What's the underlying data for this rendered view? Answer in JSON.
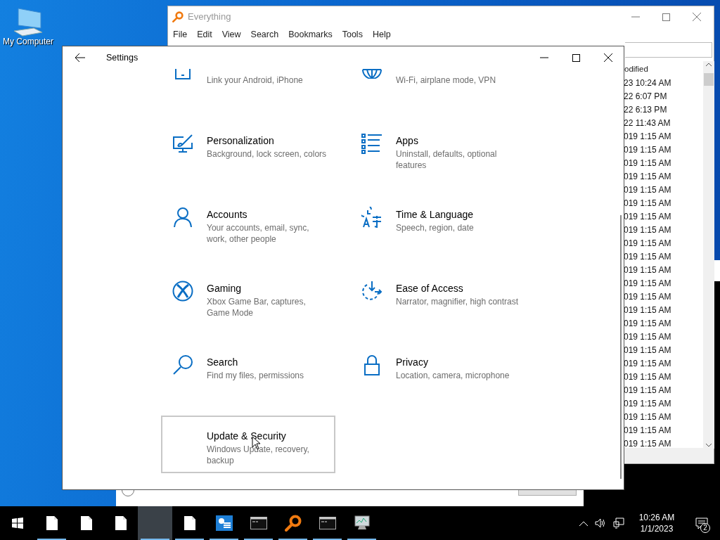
{
  "desktop": {
    "icons": [
      {
        "kind": "computer",
        "label": "My Computer"
      }
    ]
  },
  "everything_window": {
    "title": "Everything",
    "menu": [
      "File",
      "Edit",
      "View",
      "Search",
      "Bookmarks",
      "Tools",
      "Help"
    ],
    "column_header": "odified",
    "rows": [
      "23 10:24 AM",
      "22 6:07 PM",
      "22 6:13 PM",
      "22 11:43 AM",
      "019 1:15 AM",
      "019 1:15 AM",
      "019 1:15 AM",
      "019 1:15 AM",
      "019 1:15 AM",
      "019 1:15 AM",
      "019 1:15 AM",
      "019 1:15 AM",
      "019 1:15 AM",
      "019 1:15 AM",
      "019 1:15 AM",
      "019 1:15 AM",
      "019 1:15 AM",
      "019 1:15 AM",
      "019 1:15 AM",
      "019 1:15 AM",
      "019 1:15 AM",
      "019 1:15 AM",
      "019 1:15 AM",
      "019 1:15 AM",
      "019 1:15 AM",
      "019 1:15 AM",
      "019 1:15 AM",
      "019 1:15 AM"
    ]
  },
  "task_manager_window": {
    "option": {
      "selected": false
    }
  },
  "settings_window": {
    "title": "Settings",
    "items": [
      {
        "kind": "phone",
        "subtitle": "Link your Android, iPhone",
        "selected": false
      },
      {
        "kind": "network",
        "subtitle": "Wi-Fi, airplane mode, VPN",
        "selected": false
      },
      {
        "kind": "personalization",
        "title": "Personalization",
        "subtitle": "Background, lock screen, colors",
        "selected": false
      },
      {
        "kind": "apps",
        "title": "Apps",
        "subtitle": "Uninstall, defaults, optional features",
        "selected": false
      },
      {
        "kind": "accounts",
        "title": "Accounts",
        "subtitle": "Your accounts, email, sync, work, other people",
        "selected": false
      },
      {
        "kind": "time",
        "title": "Time & Language",
        "subtitle": "Speech, region, date",
        "selected": false
      },
      {
        "kind": "gaming",
        "title": "Gaming",
        "subtitle": "Xbox Game Bar, captures, Game Mode",
        "selected": false
      },
      {
        "kind": "ease",
        "title": "Ease of Access",
        "subtitle": "Narrator, magnifier, high contrast",
        "selected": false
      },
      {
        "kind": "search",
        "title": "Search",
        "subtitle": "Find my files, permissions",
        "selected": false
      },
      {
        "kind": "privacy",
        "title": "Privacy",
        "subtitle": "Location, camera, microphone",
        "selected": false
      },
      {
        "kind": "update",
        "title": "Update & Security",
        "subtitle": "Windows Update, recovery, backup",
        "selected": true
      }
    ]
  },
  "taskbar": {
    "items": [
      {
        "kind": "start",
        "running": false,
        "selected": false
      },
      {
        "kind": "file",
        "running": true,
        "selected": false
      },
      {
        "kind": "file",
        "running": false,
        "selected": false
      },
      {
        "kind": "file",
        "running": false,
        "selected": false
      },
      {
        "kind": "blank",
        "running": true,
        "selected": true
      },
      {
        "kind": "file",
        "running": true,
        "selected": false
      },
      {
        "kind": "settings",
        "running": true,
        "selected": false
      },
      {
        "kind": "console",
        "running": true,
        "selected": false
      },
      {
        "kind": "everything",
        "running": true,
        "selected": false
      },
      {
        "kind": "console",
        "running": true,
        "selected": false
      },
      {
        "kind": "monitor",
        "running": true,
        "selected": false
      }
    ],
    "time": "10:26 AM",
    "date": "1/1/2023",
    "notifications": "2"
  }
}
